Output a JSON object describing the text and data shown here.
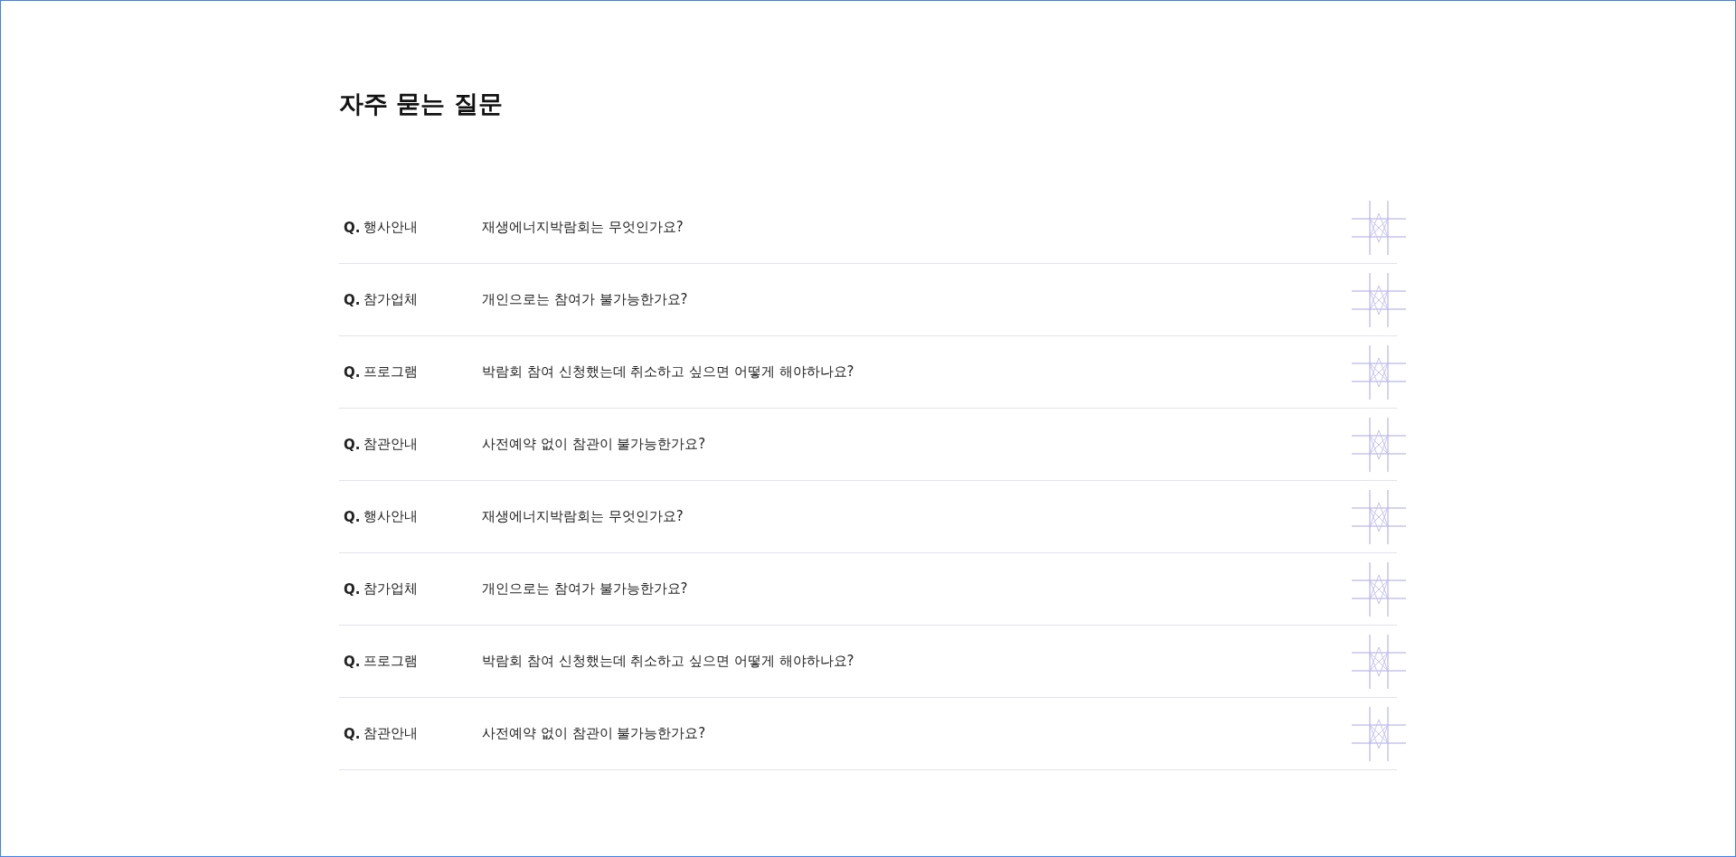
{
  "title": "자주 묻는 질문",
  "faq": [
    {
      "marker": "Q.",
      "category": "행사안내",
      "question": "재생에너지박람회는 무엇인가요?"
    },
    {
      "marker": "Q.",
      "category": "참가업체",
      "question": "개인으로는 참여가 불가능한가요?"
    },
    {
      "marker": "Q.",
      "category": "프로그램",
      "question": "박람회 참여 신청했는데 취소하고 싶으면 어떻게 해야하나요?"
    },
    {
      "marker": "Q.",
      "category": "참관안내",
      "question": "사전예약 없이 참관이 불가능한가요?"
    },
    {
      "marker": "Q.",
      "category": "행사안내",
      "question": "재생에너지박람회는 무엇인가요?"
    },
    {
      "marker": "Q.",
      "category": "참가업체",
      "question": "개인으로는 참여가 불가능한가요?"
    },
    {
      "marker": "Q.",
      "category": "프로그램",
      "question": "박람회 참여 신청했는데 취소하고 싶으면 어떻게 해야하나요?"
    },
    {
      "marker": "Q.",
      "category": "참관안내",
      "question": "사전예약 없이 참관이 불가능한가요?"
    }
  ]
}
